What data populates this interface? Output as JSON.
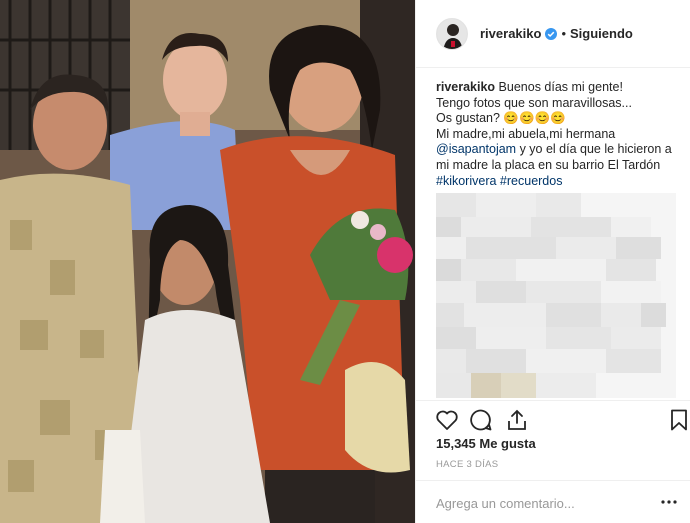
{
  "post": {
    "username": "riverakiko",
    "follow_state": "Siguiendo",
    "separator": "•"
  },
  "caption": {
    "username": "riverakiko",
    "line1": " Buenos días mi gente!",
    "line2": "Tengo fotos que son maravillosas...",
    "line3": "Os gustan? ",
    "emoji": "😊😊😊😊",
    "line4": "Mi madre,mi abuela,mi hermana",
    "mention": "@isapantojam",
    "line5_rest": " y yo el día que le hicieron a",
    "line6": "mi madre la placa en su barrio El Tardón",
    "hashtag1": "#kikorivera",
    "hashtag2": "#recuerdos"
  },
  "stats": {
    "likes": "15,345 Me gusta",
    "time": "HACE 3 DÍAS"
  },
  "comment": {
    "placeholder": "Agrega un comentario..."
  },
  "icons": {
    "verified": "verified-badge-icon",
    "like": "heart-icon",
    "comment": "comment-bubble-icon",
    "share": "share-icon",
    "save": "bookmark-icon"
  },
  "colors": {
    "verified": "#3897f0",
    "link": "#003569",
    "muted": "#999999",
    "border": "#efefef"
  }
}
